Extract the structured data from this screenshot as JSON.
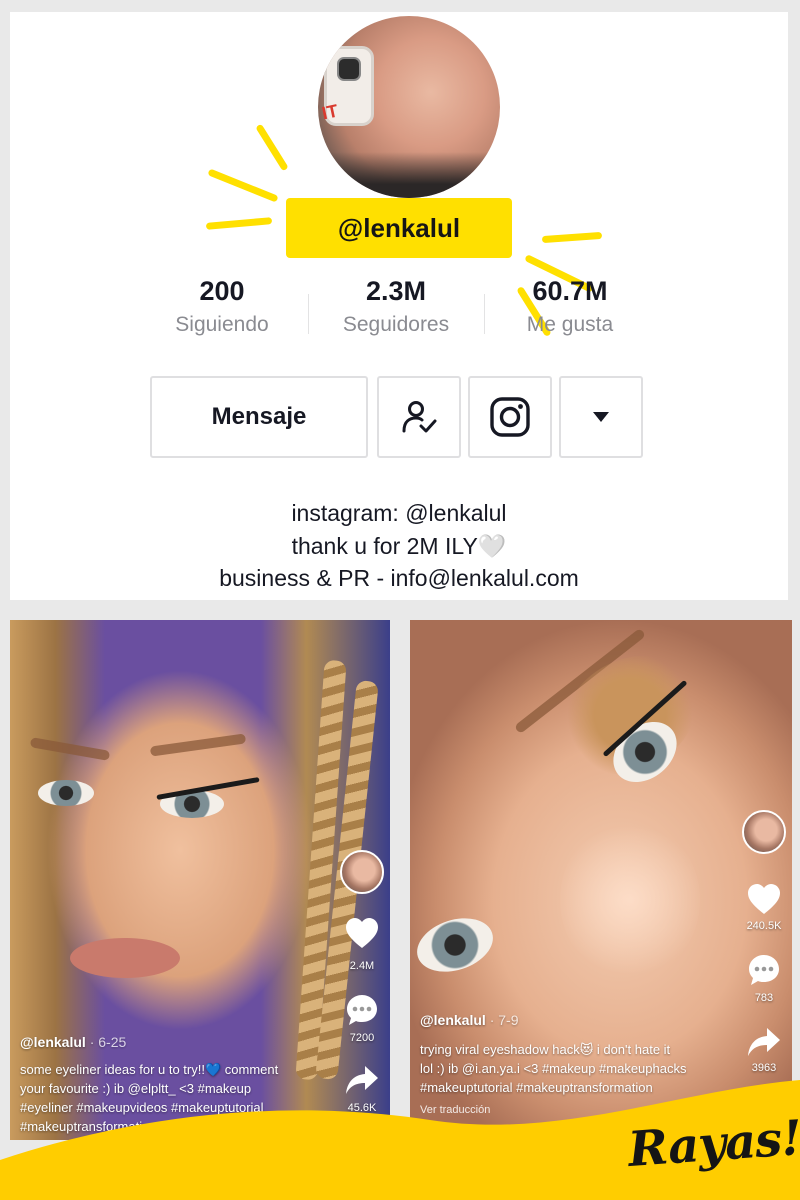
{
  "profile": {
    "username": "@lenkalul",
    "stats": [
      {
        "value": "200",
        "label": "Siguiendo"
      },
      {
        "value": "2.3M",
        "label": "Seguidores"
      },
      {
        "value": "60.7M",
        "label": "Me gusta"
      }
    ],
    "actions": {
      "message_label": "Mensaje",
      "follow_icon": "person-check-icon",
      "instagram_icon": "instagram-icon",
      "more_icon": "caret-down-icon"
    },
    "bio": [
      "instagram: @lenkalul",
      "thank u for 2M ILY🤍",
      "business & PR - info@lenkalul.com"
    ]
  },
  "videos": [
    {
      "user": "@lenkalul",
      "date": "· 6-25",
      "caption_lines": [
        "some eyeliner ideas for u to try!!💙 comment",
        "your favourite :) ib @elpltt_ <3 #makeup",
        "#eyeliner #makeupvideos #makeuptutorial",
        "#makeuptransformation"
      ],
      "likes": "2.4M",
      "comments": "7200",
      "shares": "45.6K"
    },
    {
      "user": "@lenkalul",
      "date": "· 7-9",
      "caption_lines": [
        "trying viral eyeshadow hack😻 i don't hate it",
        "lol :) ib @i.an.ya.i <3 #makeup #makeuphacks",
        "#makeuptutorial #makeuptransformation"
      ],
      "translate": "Ver traducción",
      "likes": "240.5K",
      "comments": "783",
      "shares": "3963"
    }
  ],
  "brand": {
    "name": "Rayas!",
    "accent": "#ffe000",
    "wave_color": "#ffcd00"
  }
}
